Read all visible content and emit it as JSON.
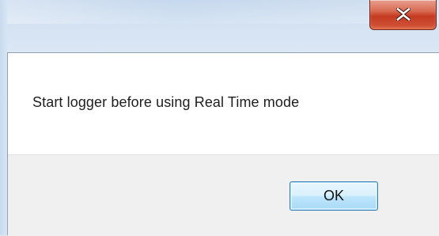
{
  "dialog": {
    "message": "Start logger before using Real Time mode",
    "ok_label": "OK",
    "close_icon": "close-icon"
  },
  "colors": {
    "close_button": "#c43b21",
    "ok_button_border": "#3c7fb1",
    "footer_background": "#f0f0f0",
    "frame": "#dce9f6"
  }
}
